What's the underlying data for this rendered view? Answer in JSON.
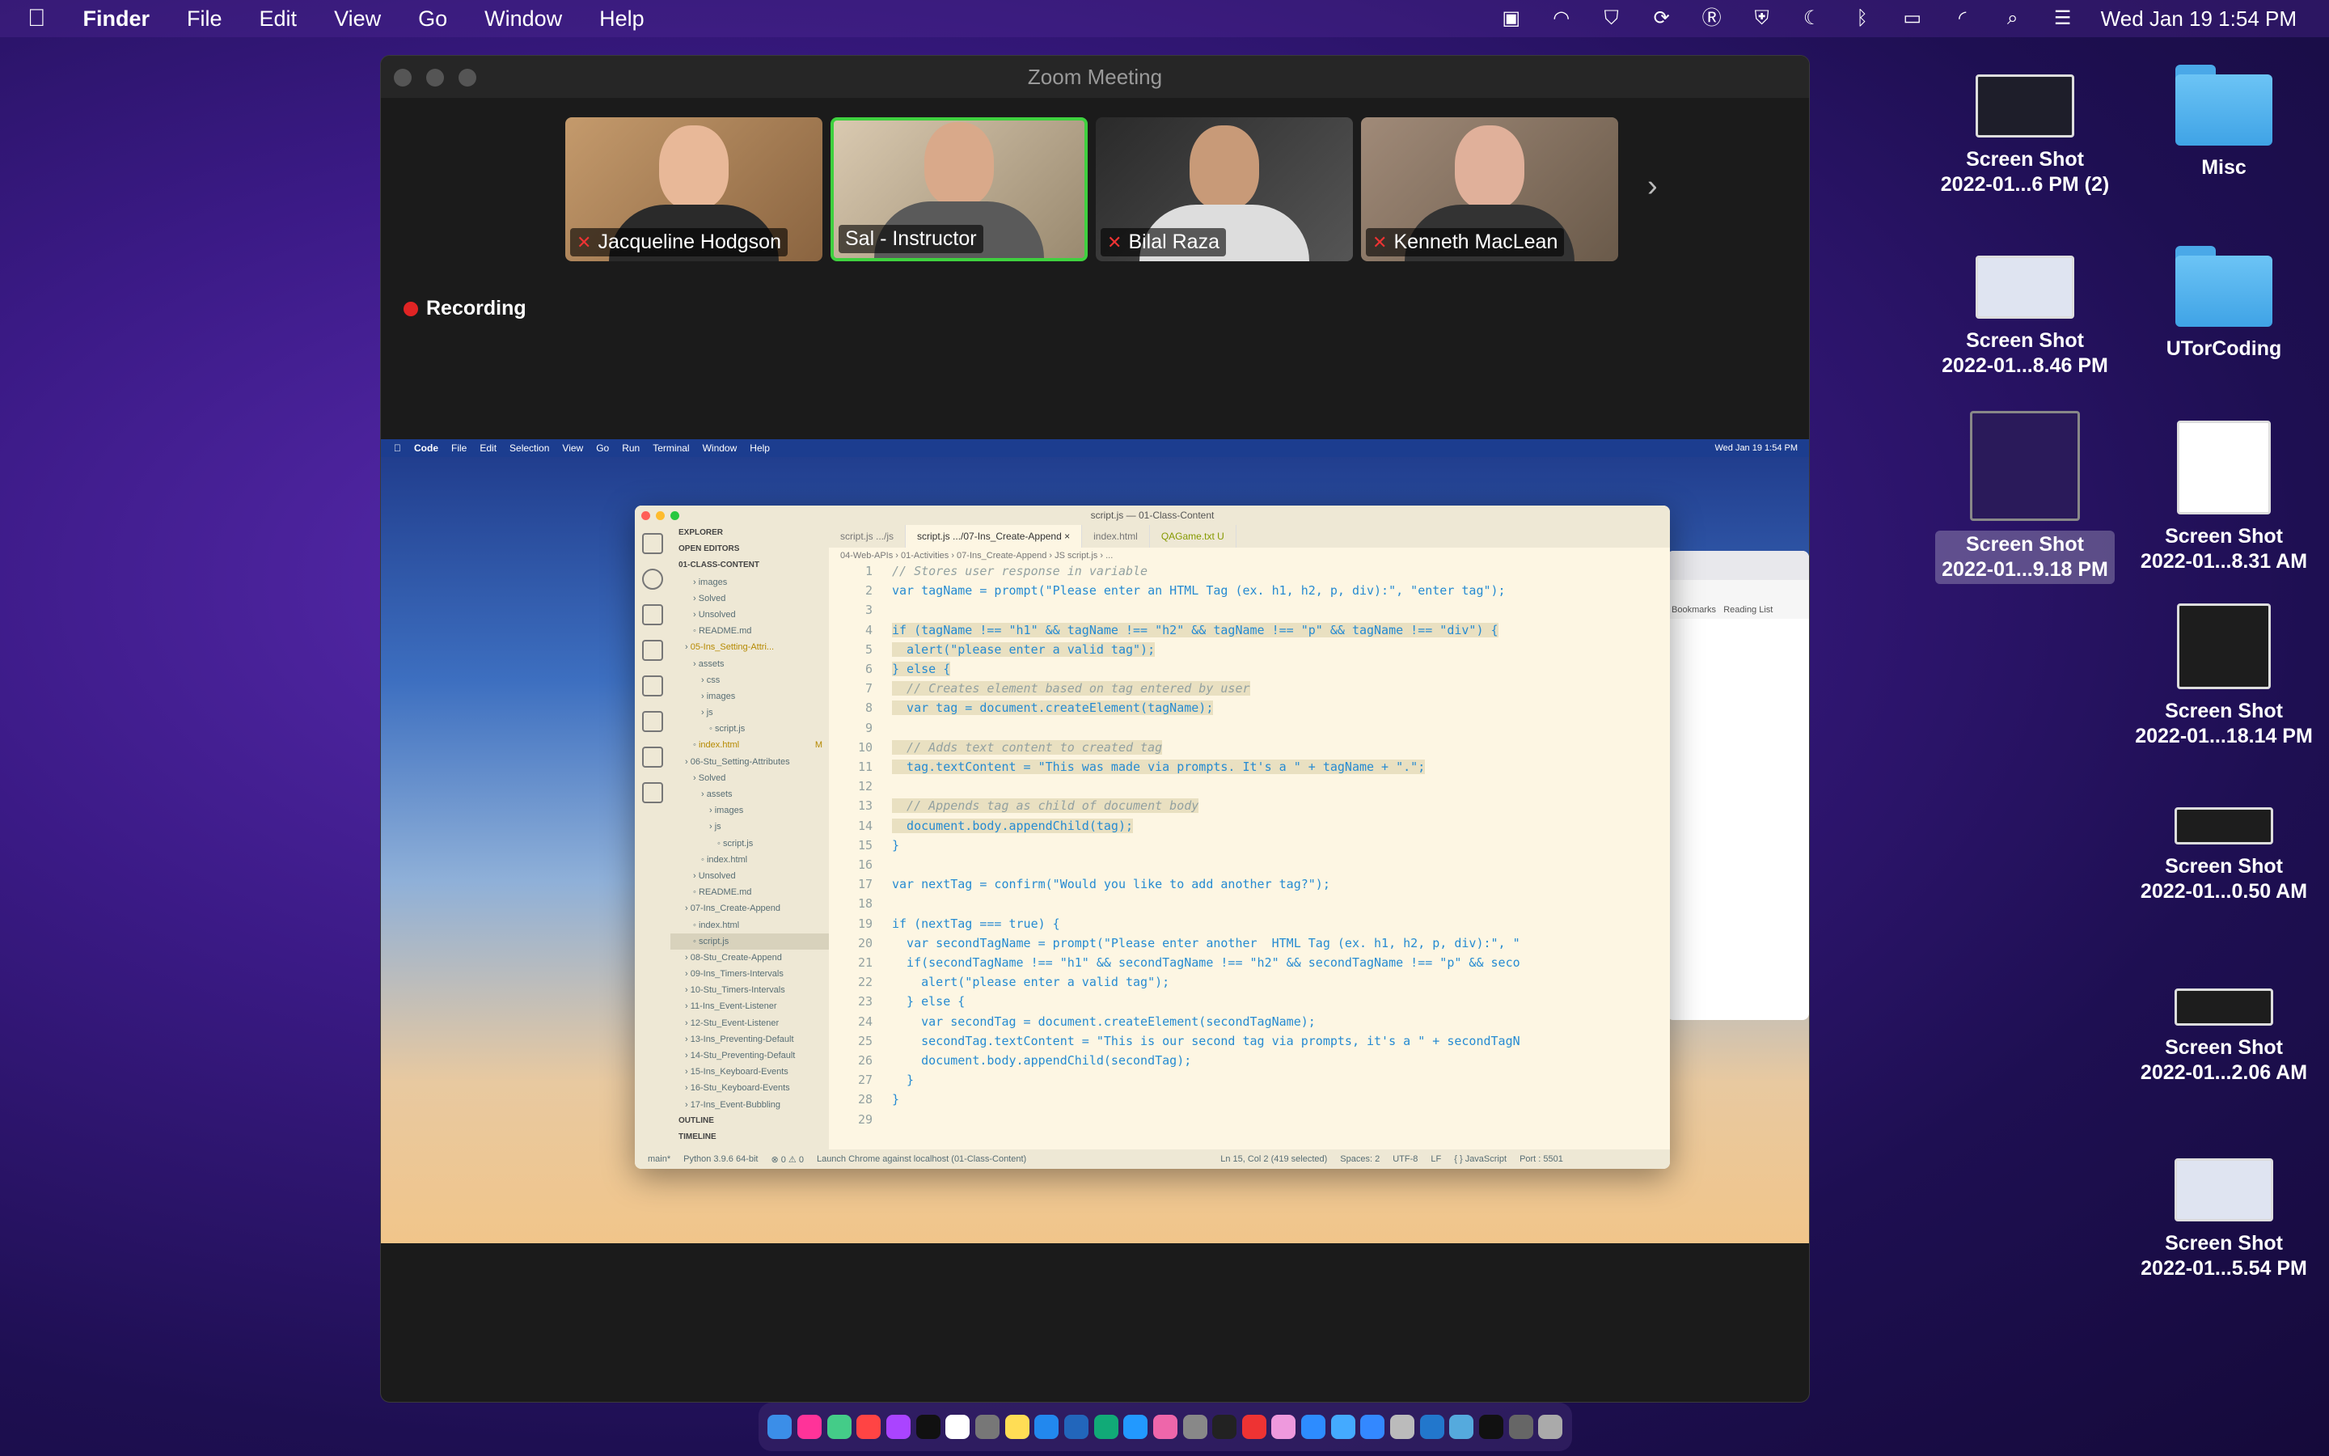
{
  "host_menubar": {
    "apple_icon": "apple-icon",
    "app_name": "Finder",
    "menus": [
      "File",
      "Edit",
      "View",
      "Go",
      "Window",
      "Help"
    ],
    "datetime": "Wed Jan 19  1:54 PM"
  },
  "desktop": {
    "items": [
      {
        "label_1": "Screen Shot",
        "label_2": "2022-01...6 PM (2)",
        "kind": "screenshot"
      },
      {
        "label_1": "Misc",
        "label_2": "",
        "kind": "folder"
      },
      {
        "label_1": "Screen Shot",
        "label_2": "2022-01...8.46 PM",
        "kind": "screenshot"
      },
      {
        "label_1": "UTorCoding",
        "label_2": "",
        "kind": "folder"
      },
      {
        "label_1": "Screen Shot",
        "label_2": "2022-01...9.18 PM",
        "kind": "screenshot",
        "selected": true
      },
      {
        "label_1": "Screen Shot",
        "label_2": "2022-01...8.31 AM",
        "kind": "screenshot"
      },
      {
        "label_1": "Screen Shot",
        "label_2": "2022-01...18.14 PM",
        "kind": "screenshot"
      },
      {
        "label_1": "Screen Shot",
        "label_2": "2022-01...0.50 AM",
        "kind": "screenshot"
      },
      {
        "label_1": "Screen Shot",
        "label_2": "2022-01...2.06 AM",
        "kind": "screenshot"
      },
      {
        "label_1": "Screen Shot",
        "label_2": "2022-01...5.54 PM",
        "kind": "screenshot"
      }
    ]
  },
  "zoom": {
    "title": "Zoom Meeting",
    "participants": [
      {
        "name": "Jacqueline  Hodgson",
        "muted": true
      },
      {
        "name": "Sal - Instructor",
        "muted": false,
        "active": true
      },
      {
        "name": "Bilal Raza",
        "muted": true
      },
      {
        "name": "Kenneth MacLean",
        "muted": true
      }
    ],
    "recording_label": "Recording",
    "next_icon": "chevron-right-icon"
  },
  "shared": {
    "menubar": {
      "app_name": "Code",
      "menus": [
        "File",
        "Edit",
        "Selection",
        "View",
        "Go",
        "Run",
        "Terminal",
        "Window",
        "Help"
      ],
      "datetime": "Wed Jan 19  1:54 PM"
    },
    "browser": {
      "bookmarks": "Bookmarks",
      "reading_list": "Reading List"
    },
    "vscode": {
      "title": "script.js — 01-Class-Content",
      "explorer_title": "EXPLORER",
      "open_editors": "OPEN EDITORS",
      "root": "01-CLASS-CONTENT",
      "tree": [
        {
          "name": "images",
          "indent": 2,
          "type": "folder"
        },
        {
          "name": "Solved",
          "indent": 2,
          "type": "folder"
        },
        {
          "name": "Unsolved",
          "indent": 2,
          "type": "folder"
        },
        {
          "name": "README.md",
          "indent": 2,
          "type": "file"
        },
        {
          "name": "05-Ins_Setting-Attri...",
          "indent": 1,
          "type": "folder",
          "modified": true
        },
        {
          "name": "assets",
          "indent": 2,
          "type": "folder"
        },
        {
          "name": "css",
          "indent": 3,
          "type": "folder"
        },
        {
          "name": "images",
          "indent": 3,
          "type": "folder"
        },
        {
          "name": "js",
          "indent": 3,
          "type": "folder"
        },
        {
          "name": "script.js",
          "indent": 4,
          "type": "file"
        },
        {
          "name": "index.html",
          "indent": 2,
          "type": "file",
          "badge": "M"
        },
        {
          "name": "06-Stu_Setting-Attributes",
          "indent": 1,
          "type": "folder"
        },
        {
          "name": "Solved",
          "indent": 2,
          "type": "folder"
        },
        {
          "name": "assets",
          "indent": 3,
          "type": "folder"
        },
        {
          "name": "images",
          "indent": 4,
          "type": "folder"
        },
        {
          "name": "js",
          "indent": 4,
          "type": "folder"
        },
        {
          "name": "script.js",
          "indent": 5,
          "type": "file"
        },
        {
          "name": "index.html",
          "indent": 3,
          "type": "file"
        },
        {
          "name": "Unsolved",
          "indent": 2,
          "type": "folder"
        },
        {
          "name": "README.md",
          "indent": 2,
          "type": "file"
        },
        {
          "name": "07-Ins_Create-Append",
          "indent": 1,
          "type": "folder"
        },
        {
          "name": "index.html",
          "indent": 2,
          "type": "file"
        },
        {
          "name": "script.js",
          "indent": 2,
          "type": "file",
          "selected": true
        },
        {
          "name": "08-Stu_Create-Append",
          "indent": 1,
          "type": "folder"
        },
        {
          "name": "09-Ins_Timers-Intervals",
          "indent": 1,
          "type": "folder"
        },
        {
          "name": "10-Stu_Timers-Intervals",
          "indent": 1,
          "type": "folder"
        },
        {
          "name": "11-Ins_Event-Listener",
          "indent": 1,
          "type": "folder"
        },
        {
          "name": "12-Stu_Event-Listener",
          "indent": 1,
          "type": "folder"
        },
        {
          "name": "13-Ins_Preventing-Default",
          "indent": 1,
          "type": "folder"
        },
        {
          "name": "14-Stu_Preventing-Default",
          "indent": 1,
          "type": "folder"
        },
        {
          "name": "15-Ins_Keyboard-Events",
          "indent": 1,
          "type": "folder"
        },
        {
          "name": "16-Stu_Keyboard-Events",
          "indent": 1,
          "type": "folder"
        },
        {
          "name": "17-Ins_Event-Bubbling",
          "indent": 1,
          "type": "folder"
        }
      ],
      "outline": "OUTLINE",
      "timeline": "TIMELINE",
      "tabs": [
        {
          "label": "script.js  .../js",
          "active": false
        },
        {
          "label": "script.js  .../07-Ins_Create-Append  ×",
          "active": true
        },
        {
          "label": "index.html",
          "active": false
        },
        {
          "label": "QAGame.txt  U",
          "active": false
        }
      ],
      "breadcrumbs": "04-Web-APIs  ›  01-Activities  ›  07-Ins_Create-Append  ›  JS script.js  ›  ...",
      "code_lines": [
        {
          "n": "1",
          "text": "// Stores user response in variable",
          "cls": "cm"
        },
        {
          "n": "2",
          "text": "var tagName = prompt(\"Please enter an HTML Tag (ex. h1, h2, p, div):\", \"enter tag\");",
          "cls": ""
        },
        {
          "n": "3",
          "text": "",
          "cls": ""
        },
        {
          "n": "4",
          "text": "if (tagName !== \"h1\" && tagName !== \"h2\" && tagName !== \"p\" && tagName !== \"div\") {",
          "cls": "",
          "sel": true
        },
        {
          "n": "5",
          "text": "  alert(\"please enter a valid tag\");",
          "cls": "",
          "sel": true
        },
        {
          "n": "6",
          "text": "} else {",
          "cls": "",
          "sel": true
        },
        {
          "n": "7",
          "text": "  // Creates element based on tag entered by user",
          "cls": "cm",
          "sel": true
        },
        {
          "n": "8",
          "text": "  var tag = document.createElement(tagName);",
          "cls": "",
          "sel": true
        },
        {
          "n": "9",
          "text": "",
          "cls": ""
        },
        {
          "n": "10",
          "text": "  // Adds text content to created tag",
          "cls": "cm",
          "sel": true
        },
        {
          "n": "11",
          "text": "  tag.textContent = \"This was made via prompts. It's a \" + tagName + \".\";",
          "cls": "",
          "sel": true
        },
        {
          "n": "12",
          "text": "",
          "cls": ""
        },
        {
          "n": "13",
          "text": "  // Appends tag as child of document body",
          "cls": "cm",
          "sel": true
        },
        {
          "n": "14",
          "text": "  document.body.appendChild(tag);",
          "cls": "",
          "sel": true
        },
        {
          "n": "15",
          "text": "}",
          "cls": ""
        },
        {
          "n": "16",
          "text": "",
          "cls": ""
        },
        {
          "n": "17",
          "text": "var nextTag = confirm(\"Would you like to add another tag?\");",
          "cls": ""
        },
        {
          "n": "18",
          "text": "",
          "cls": ""
        },
        {
          "n": "19",
          "text": "if (nextTag === true) {",
          "cls": ""
        },
        {
          "n": "20",
          "text": "  var secondTagName = prompt(\"Please enter another  HTML Tag (ex. h1, h2, p, div):\", \"",
          "cls": ""
        },
        {
          "n": "21",
          "text": "  if(secondTagName !== \"h1\" && secondTagName !== \"h2\" && secondTagName !== \"p\" && seco",
          "cls": ""
        },
        {
          "n": "22",
          "text": "    alert(\"please enter a valid tag\");",
          "cls": ""
        },
        {
          "n": "23",
          "text": "  } else {",
          "cls": ""
        },
        {
          "n": "24",
          "text": "    var secondTag = document.createElement(secondTagName);",
          "cls": ""
        },
        {
          "n": "25",
          "text": "    secondTag.textContent = \"This is our second tag via prompts, it's a \" + secondTagN",
          "cls": ""
        },
        {
          "n": "26",
          "text": "    document.body.appendChild(secondTag);",
          "cls": ""
        },
        {
          "n": "27",
          "text": "  }",
          "cls": ""
        },
        {
          "n": "28",
          "text": "}",
          "cls": ""
        },
        {
          "n": "29",
          "text": "",
          "cls": ""
        }
      ],
      "status": {
        "branch": "main*",
        "python": "Python 3.9.6 64-bit",
        "problems": "⊗ 0 ⚠ 0",
        "launch": "Launch Chrome against localhost (01-Class-Content)",
        "cursor": "Ln 15, Col 2 (419 selected)",
        "spaces": "Spaces: 2",
        "encoding": "UTF-8",
        "eol": "LF",
        "language": "{ } JavaScript",
        "port": "Port : 5501"
      }
    }
  },
  "colors": {
    "desktop_bg": "#3b1a86",
    "active_speaker_border": "#3fd13f",
    "recording_dot": "#e02424",
    "vscode_bg": "#fdf6e3"
  }
}
